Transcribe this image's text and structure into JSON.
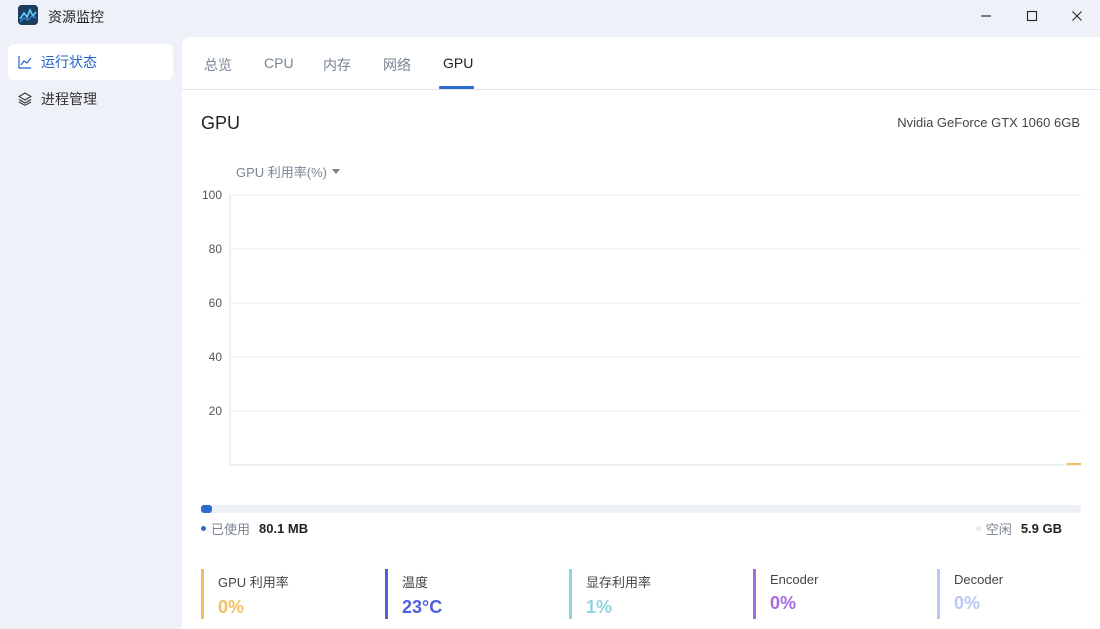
{
  "window": {
    "title": "资源监控",
    "minimize_icon": "minimize-icon",
    "maximize_icon": "maximize-icon",
    "close_icon": "close-icon"
  },
  "sidebar": {
    "items": [
      {
        "label": "运行状态",
        "icon": "line-chart-icon",
        "active": true
      },
      {
        "label": "进程管理",
        "icon": "layers-icon",
        "active": false
      }
    ]
  },
  "tabs": [
    {
      "label": "总览"
    },
    {
      "label": "CPU"
    },
    {
      "label": "内存"
    },
    {
      "label": "网络"
    },
    {
      "label": "GPU",
      "active": true
    }
  ],
  "gpu": {
    "heading": "GPU",
    "model": "Nvidia GeForce GTX 1060 6GB",
    "metric_selector": "GPU 利用率(%)"
  },
  "chart_data": {
    "type": "line",
    "ylim": [
      0,
      100
    ],
    "yticks": [
      "100",
      "80",
      "60",
      "40",
      "20"
    ],
    "grid": true,
    "series": [
      {
        "color": "#f2c061",
        "values": [
          0,
          0
        ]
      }
    ]
  },
  "memory": {
    "used_label": "已使用",
    "used_value": "80.1 MB",
    "free_label": "空闲",
    "free_value": "5.9 GB",
    "used_fraction": 0.013,
    "used_color": "#2b6ccc",
    "free_color": "#e6e9ee"
  },
  "stats": [
    {
      "label": "GPU 利用率",
      "value": "0%",
      "color": "#f2c061"
    },
    {
      "label": "温度",
      "value": "23°C",
      "color": "#4e5fe0"
    },
    {
      "label": "显存利用率",
      "value": "1%",
      "color": "#8fd3e0"
    },
    {
      "label": "Encoder",
      "value": "0%",
      "color": "#a86ae0"
    },
    {
      "label": "Decoder",
      "value": "0%",
      "color": "#b8c8f5"
    }
  ]
}
